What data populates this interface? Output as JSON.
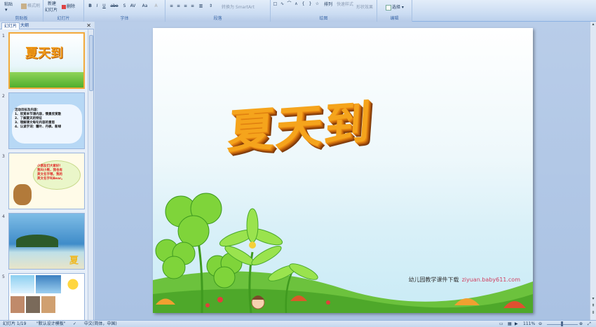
{
  "ribbon": {
    "clipboard": {
      "paste": "粘贴",
      "format_painter": "格式刷",
      "label": "剪贴板"
    },
    "slides": {
      "new_slide": "新建",
      "new_slide_2": "幻灯片",
      "delete": "删除",
      "label": "幻灯片"
    },
    "font": {
      "label": "字体"
    },
    "paragraph": {
      "smartart": "转换为 SmartArt",
      "label": "段落"
    },
    "drawing": {
      "arrange": "排列",
      "quick_styles": "快速样式",
      "shape_effects": "形状效果",
      "label": "绘图"
    },
    "editing": {
      "select": "选择",
      "label": "编辑"
    }
  },
  "left_pane": {
    "tab_slides": "幻灯片",
    "tab_outline": "大纲",
    "thumbs": [
      {
        "num": "1",
        "title": "夏天到"
      },
      {
        "num": "2",
        "lines": [
          "活动目标及内容：",
          "1、欣赏本节课内容，情景欣赏歌",
          "2、了解夏天的特征",
          "3、理解课文每句内容的意思",
          "4、认读字词：霜叶、丹枫、新绿"
        ]
      },
      {
        "num": "3",
        "bubble": [
          "小朋友们大家好！",
          "我叫小熊，我也有",
          "英文名字哦，我的",
          "英文名字叫Bear。"
        ]
      },
      {
        "num": "4",
        "char": "夏"
      },
      {
        "num": "5"
      }
    ]
  },
  "slide": {
    "title": "夏天到",
    "credit_text": "幼儿园教学课件下载",
    "credit_url": "ziyuan.baby611.com"
  },
  "status": {
    "slide_pos": "幻灯片 1/19",
    "theme": "\"默认设计模板\"",
    "lang": "中文(简体，中国)",
    "zoom": "111%"
  }
}
